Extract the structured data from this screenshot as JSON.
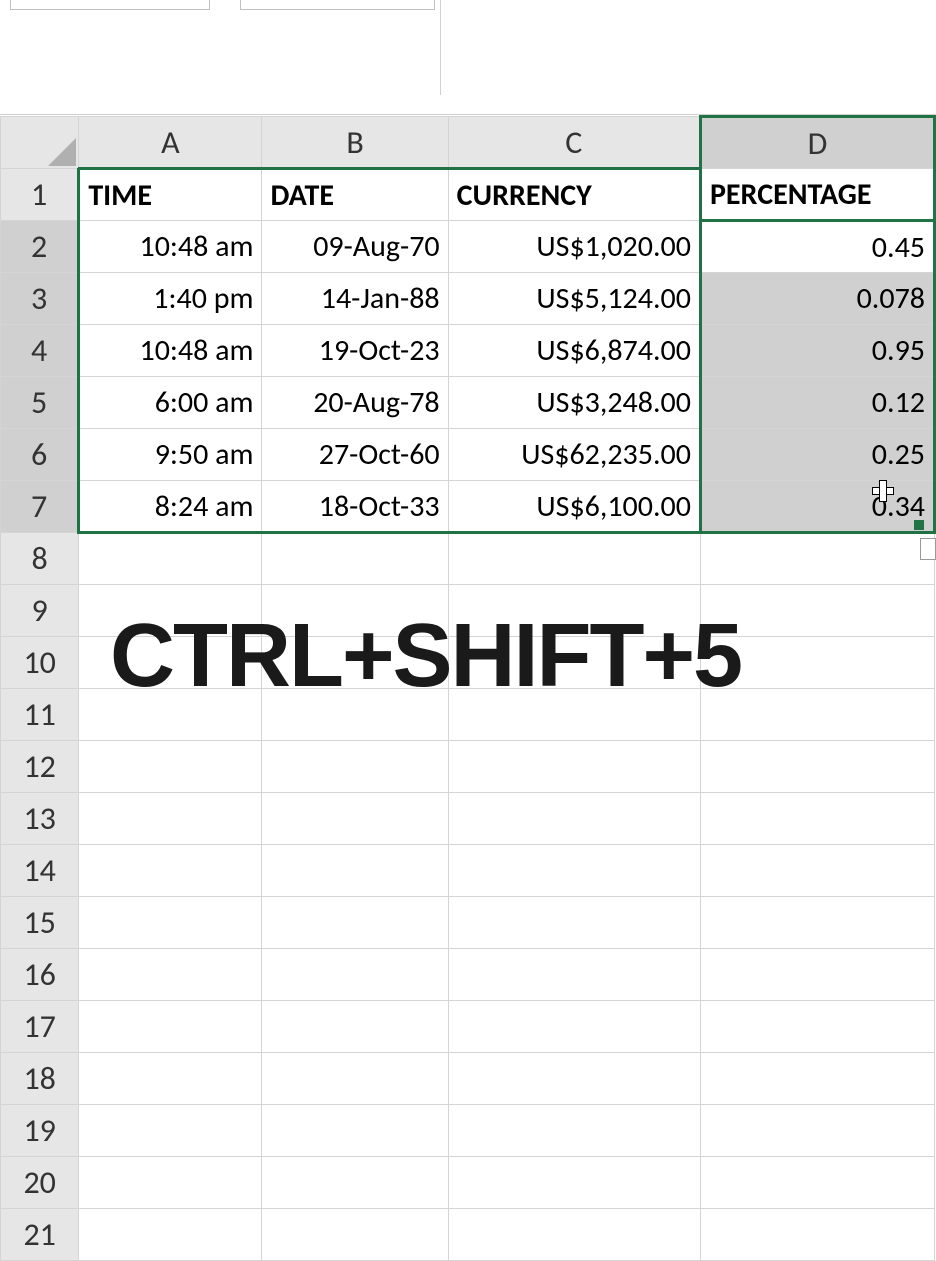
{
  "columns": [
    "A",
    "B",
    "C",
    "D"
  ],
  "rows": [
    "1",
    "2",
    "3",
    "4",
    "5",
    "6",
    "7",
    "8",
    "9",
    "10",
    "11",
    "12",
    "13",
    "14",
    "15",
    "16",
    "17",
    "18",
    "19",
    "20",
    "21"
  ],
  "headers": {
    "time": "TIME",
    "date": "DATE",
    "currency": "CURRENCY",
    "percentage": "PERCENTAGE"
  },
  "data": [
    {
      "time": "10:48 am",
      "date": "09-Aug-70",
      "currency": "US$1,020.00",
      "percentage": "0.45"
    },
    {
      "time": "1:40 pm",
      "date": "14-Jan-88",
      "currency": "US$5,124.00",
      "percentage": "0.078"
    },
    {
      "time": "10:48 am",
      "date": "19-Oct-23",
      "currency": "US$6,874.00",
      "percentage": "0.95"
    },
    {
      "time": "6:00 am",
      "date": "20-Aug-78",
      "currency": "US$3,248.00",
      "percentage": "0.12"
    },
    {
      "time": "9:50 am",
      "date": "27-Oct-60",
      "currency": "US$62,235.00",
      "percentage": "0.25"
    },
    {
      "time": "8:24 am",
      "date": "18-Oct-33",
      "currency": "US$6,100.00",
      "percentage": "0.34"
    }
  ],
  "overlay": "CTRL+SHIFT+5"
}
